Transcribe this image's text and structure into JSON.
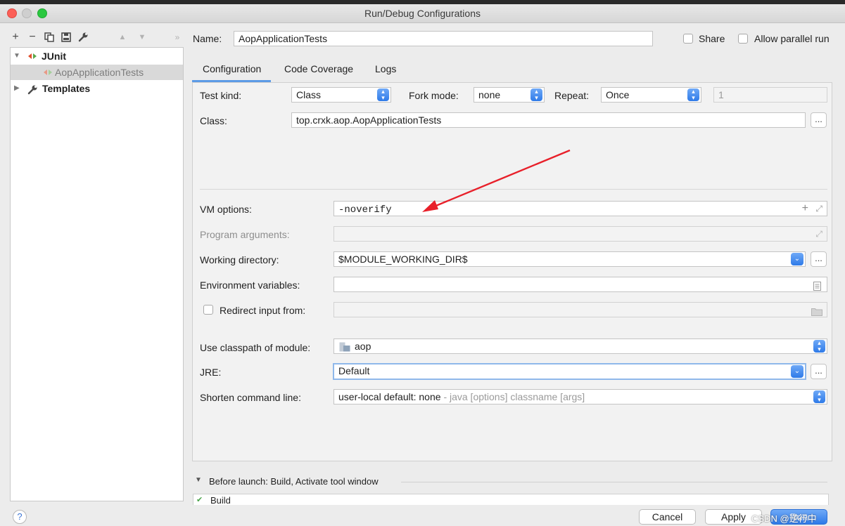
{
  "window": {
    "title": "Run/Debug Configurations"
  },
  "tree": {
    "junit": "JUnit",
    "child": "AopApplicationTests",
    "templates": "Templates"
  },
  "header": {
    "name_label": "Name:",
    "name_value": "AopApplicationTests",
    "share_label": "Share",
    "parallel_label": "Allow parallel run"
  },
  "tabs": [
    "Configuration",
    "Code Coverage",
    "Logs"
  ],
  "config": {
    "test_kind_label": "Test kind:",
    "test_kind_value": "Class",
    "fork_mode_label": "Fork mode:",
    "fork_mode_value": "none",
    "repeat_label": "Repeat:",
    "repeat_value": "Once",
    "repeat_count": "1",
    "class_label": "Class:",
    "class_value": "top.crxk.aop.AopApplicationTests",
    "vm_options_label": "VM options:",
    "vm_options_value": "-noverify",
    "program_args_label": "Program arguments:",
    "working_dir_label": "Working directory:",
    "working_dir_value": "$MODULE_WORKING_DIR$",
    "env_vars_label": "Environment variables:",
    "redirect_label": "Redirect input from:",
    "classpath_label": "Use classpath of module:",
    "classpath_value": "aop",
    "jre_label": "JRE:",
    "jre_value": "Default",
    "shorten_label": "Shorten command line:",
    "shorten_value": "user-local default: none",
    "shorten_hint": "- java [options] classname [args]"
  },
  "before_launch": "Before launch: Build, Activate tool window",
  "before_launch_item": "Build",
  "buttons": {
    "cancel": "Cancel",
    "apply": "Apply",
    "run": "Run",
    "help": "?",
    "ellipsis": "..."
  },
  "watermark": "CSDN @逆行中",
  "colors": {
    "accent": "#2e7ae8",
    "annotation_arrow": "#e8202a"
  }
}
